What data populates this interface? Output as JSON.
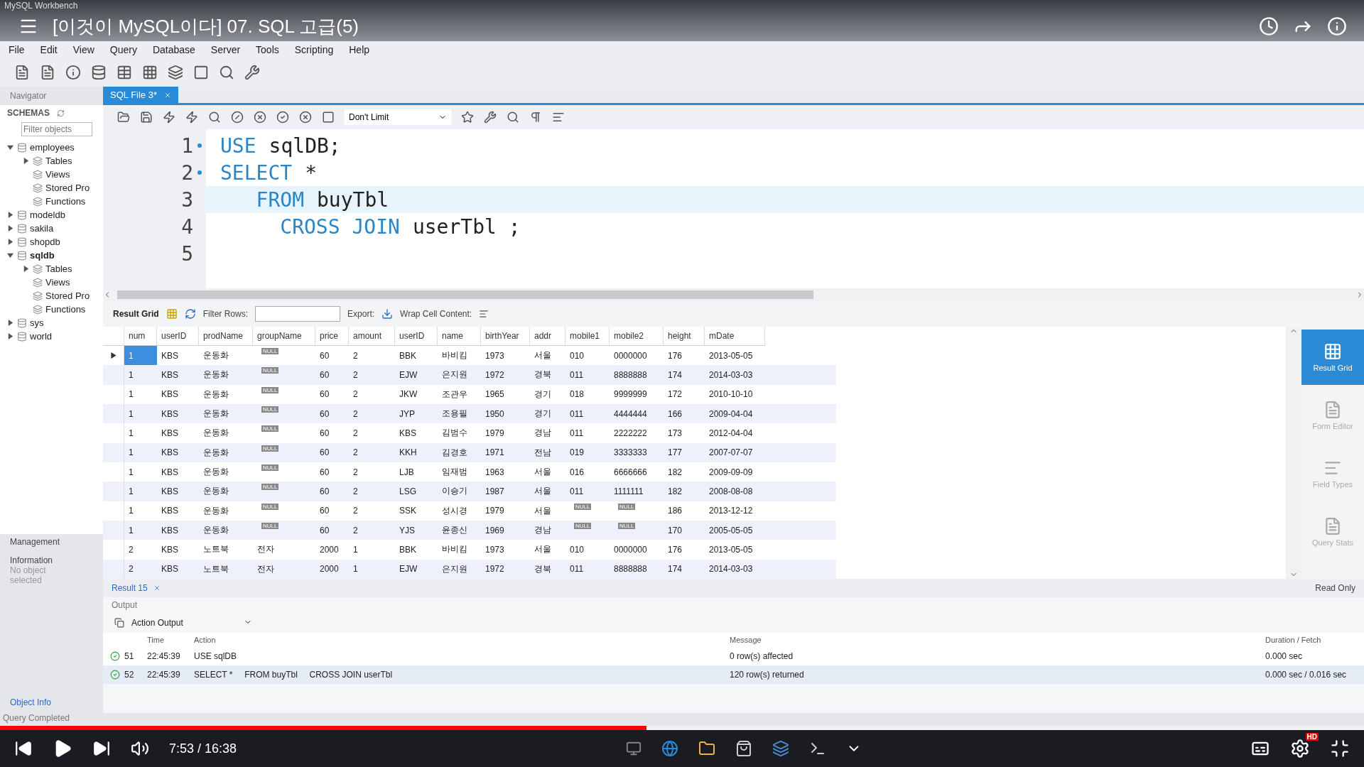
{
  "video": {
    "title": "[이것이 MySQL이다] 07. SQL 고급(5)",
    "time": "7:53 / 16:38",
    "progress": {
      "level": 0.474
    },
    "quality_badge": "HD"
  },
  "app": {
    "title": "MySQL Workbench",
    "menu": [
      "File",
      "Edit",
      "View",
      "Query",
      "Database",
      "Server",
      "Tools",
      "Scripting",
      "Help"
    ],
    "navigator": {
      "label": "Navigator",
      "schemas_label": "SCHEMAS",
      "filter_placeholder": "Filter objects",
      "tree": [
        {
          "label": "employees",
          "expanded": true,
          "selected": false,
          "children": [
            {
              "label": "Tables",
              "expanded": false,
              "selected": false
            },
            {
              "label": "Views",
              "selected": false
            },
            {
              "label": "Stored Pro",
              "selected": false
            },
            {
              "label": "Functions",
              "selected": false
            }
          ]
        },
        {
          "label": "modeldb",
          "expanded": false,
          "selected": false
        },
        {
          "label": "sakila",
          "expanded": false,
          "selected": false
        },
        {
          "label": "shopdb",
          "expanded": false,
          "selected": false
        },
        {
          "label": "sqldb",
          "expanded": true,
          "selected": true,
          "children": [
            {
              "label": "Tables",
              "expanded": false,
              "selected": false
            },
            {
              "label": "Views",
              "selected": false
            },
            {
              "label": "Stored Pro",
              "selected": false
            },
            {
              "label": "Functions",
              "selected": false
            }
          ]
        },
        {
          "label": "sys",
          "expanded": false,
          "selected": false
        },
        {
          "label": "world",
          "expanded": false,
          "selected": false
        }
      ],
      "management_label": "Management",
      "information_label": "Information",
      "information_text": "No object selected",
      "object_info_label": "Object Info"
    },
    "editor_tab": {
      "label": "SQL File 3*",
      "selected": true
    },
    "limit": "Don't Limit",
    "code": [
      {
        "number": "1",
        "marker": true,
        "current": false,
        "tokens": [
          {
            "kind": "keyword",
            "text": "USE"
          },
          {
            "kind": "ident",
            "text": "sqlDB;"
          }
        ]
      },
      {
        "number": "2",
        "marker": true,
        "current": false,
        "tokens": [
          {
            "kind": "keyword",
            "text": "SELECT"
          },
          {
            "kind": "ident",
            "text": "*"
          }
        ]
      },
      {
        "number": "3",
        "marker": false,
        "current": true,
        "tokens": [
          {
            "kind": "keyword",
            "text": "   FROM"
          },
          {
            "kind": "ident",
            "text": "buyTbl"
          }
        ]
      },
      {
        "number": "4",
        "marker": false,
        "current": false,
        "tokens": [
          {
            "kind": "keyword",
            "text": "     CROSS JOIN"
          },
          {
            "kind": "ident",
            "text": "userTbl ;"
          }
        ]
      },
      {
        "number": "5",
        "marker": false,
        "current": false
      }
    ],
    "result_toolbar": {
      "grid_label": "Result Grid",
      "filter_label": "Filter Rows:",
      "export_label": "Export:",
      "wrap_label": "Wrap Cell Content:"
    },
    "grid": {
      "columns": [
        "num",
        "userID",
        "prodName",
        "groupName",
        "price",
        "amount",
        "userID",
        "name",
        "birthYear",
        "addr",
        "mobile1",
        "mobile2",
        "height",
        "mDate"
      ],
      "rows": [
        {
          "selected": true,
          "cells": [
            "1",
            "KBS",
            "운동화",
            {
              "kind": "null",
              "text": "NULL"
            },
            "60",
            "2",
            "BBK",
            "바비킴",
            "1973",
            "서울",
            "010",
            "0000000",
            "176",
            "2013-05-05"
          ]
        },
        {
          "selected": false,
          "cells": [
            "1",
            "KBS",
            "운동화",
            {
              "kind": "null",
              "text": "NULL"
            },
            "60",
            "2",
            "EJW",
            "은지원",
            "1972",
            "경북",
            "011",
            "8888888",
            "174",
            "2014-03-03"
          ]
        },
        {
          "selected": false,
          "cells": [
            "1",
            "KBS",
            "운동화",
            {
              "kind": "null",
              "text": "NULL"
            },
            "60",
            "2",
            "JKW",
            "조관우",
            "1965",
            "경기",
            "018",
            "9999999",
            "172",
            "2010-10-10"
          ]
        },
        {
          "selected": false,
          "cells": [
            "1",
            "KBS",
            "운동화",
            {
              "kind": "null",
              "text": "NULL"
            },
            "60",
            "2",
            "JYP",
            "조용필",
            "1950",
            "경기",
            "011",
            "4444444",
            "166",
            "2009-04-04"
          ]
        },
        {
          "selected": false,
          "cells": [
            "1",
            "KBS",
            "운동화",
            {
              "kind": "null",
              "text": "NULL"
            },
            "60",
            "2",
            "KBS",
            "김범수",
            "1979",
            "경남",
            "011",
            "2222222",
            "173",
            "2012-04-04"
          ]
        },
        {
          "selected": false,
          "cells": [
            "1",
            "KBS",
            "운동화",
            {
              "kind": "null",
              "text": "NULL"
            },
            "60",
            "2",
            "KKH",
            "김경호",
            "1971",
            "전남",
            "019",
            "3333333",
            "177",
            "2007-07-07"
          ]
        },
        {
          "selected": false,
          "cells": [
            "1",
            "KBS",
            "운동화",
            {
              "kind": "null",
              "text": "NULL"
            },
            "60",
            "2",
            "LJB",
            "임재범",
            "1963",
            "서울",
            "016",
            "6666666",
            "182",
            "2009-09-09"
          ]
        },
        {
          "selected": false,
          "cells": [
            "1",
            "KBS",
            "운동화",
            {
              "kind": "null",
              "text": "NULL"
            },
            "60",
            "2",
            "LSG",
            "이승기",
            "1987",
            "서울",
            "011",
            "1111111",
            "182",
            "2008-08-08"
          ]
        },
        {
          "selected": false,
          "cells": [
            "1",
            "KBS",
            "운동화",
            {
              "kind": "null",
              "text": "NULL"
            },
            "60",
            "2",
            "SSK",
            "성시경",
            "1979",
            "서울",
            {
              "kind": "null",
              "text": "NULL"
            },
            {
              "kind": "null",
              "text": "NULL"
            },
            "186",
            "2013-12-12"
          ]
        },
        {
          "selected": false,
          "cells": [
            "1",
            "KBS",
            "운동화",
            {
              "kind": "null",
              "text": "NULL"
            },
            "60",
            "2",
            "YJS",
            "윤종신",
            "1969",
            "경남",
            {
              "kind": "null",
              "text": "NULL"
            },
            {
              "kind": "null",
              "text": "NULL"
            },
            "170",
            "2005-05-05"
          ]
        },
        {
          "selected": false,
          "cells": [
            "2",
            "KBS",
            "노트북",
            "전자",
            "2000",
            "1",
            "BBK",
            "바비킴",
            "1973",
            "서울",
            "010",
            "0000000",
            "176",
            "2013-05-05"
          ]
        },
        {
          "selected": false,
          "cells": [
            "2",
            "KBS",
            "노트북",
            "전자",
            "2000",
            "1",
            "EJW",
            "은지원",
            "1972",
            "경북",
            "011",
            "8888888",
            "174",
            "2014-03-03"
          ]
        }
      ]
    },
    "side_tabs": [
      {
        "label": "Result Grid",
        "selected": true
      },
      {
        "label": "Form Editor",
        "selected": false
      },
      {
        "label": "Field Types",
        "selected": false
      },
      {
        "label": "Query Stats",
        "selected": false
      }
    ],
    "result_tab": "Result 15",
    "read_only": "Read Only",
    "output": {
      "label": "Output",
      "mode": "Action Output",
      "columns": [
        "Time",
        "Action",
        "Message",
        "Duration / Fetch"
      ],
      "rows": [
        {
          "kind": "success",
          "number": "51",
          "time": "22:45:39",
          "action": "USE sqlDB",
          "message": "0 row(s) affected",
          "duration": "0.000 sec"
        },
        {
          "kind": "success",
          "number": "52",
          "time": "22:45:39",
          "action": "SELECT *     FROM buyTbl     CROSS JOIN userTbl",
          "message": "120 row(s) returned",
          "duration": "0.000 sec / 0.016 sec"
        }
      ]
    },
    "status": "Query Completed"
  }
}
